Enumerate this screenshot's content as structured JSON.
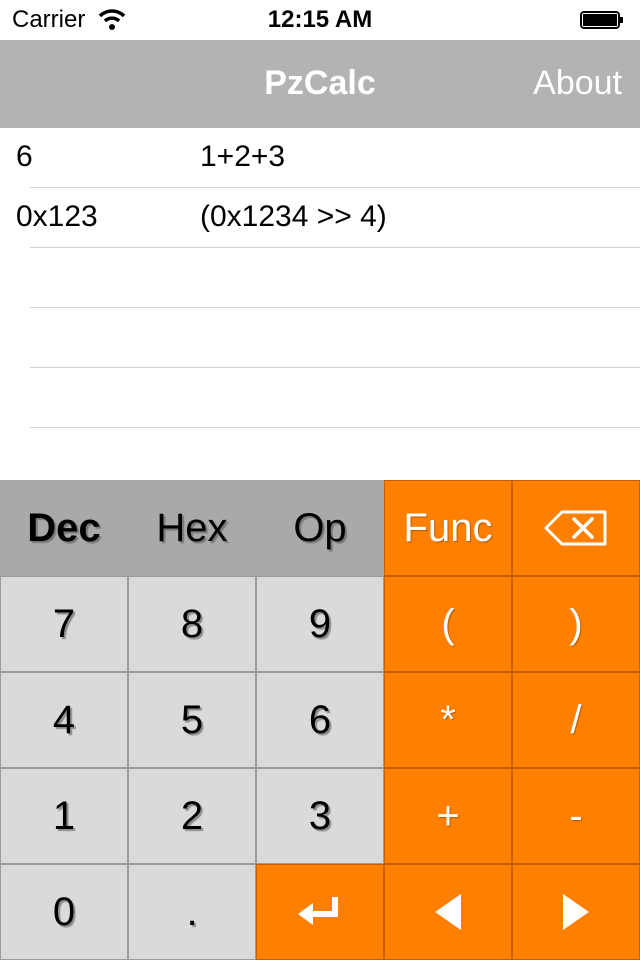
{
  "status_bar": {
    "carrier": "Carrier",
    "time": "12:15 AM"
  },
  "nav": {
    "title": "PzCalc",
    "about_label": "About"
  },
  "history": [
    {
      "result": "6",
      "expression": "1+2+3"
    },
    {
      "result": "0x123",
      "expression": "(0x1234 >> 4)"
    },
    {
      "result": "",
      "expression": ""
    },
    {
      "result": "",
      "expression": ""
    },
    {
      "result": "",
      "expression": ""
    }
  ],
  "keypad": {
    "modes": [
      "Dec",
      "Hex",
      "Op"
    ],
    "active_mode": "Dec",
    "func_label": "Func",
    "backspace_icon": "backspace-icon",
    "digits": [
      "7",
      "8",
      "9",
      "4",
      "5",
      "6",
      "1",
      "2",
      "3",
      "0",
      "."
    ],
    "operators": [
      "(",
      ")",
      "*",
      "/",
      "+",
      "-"
    ],
    "enter_icon": "enter-icon",
    "left_icon": "arrow-left-icon",
    "right_icon": "arrow-right-icon"
  },
  "colors": {
    "accent": "#ff8000",
    "nav_bg": "#b3b3b3",
    "key_gray": "#dadada",
    "mode_bg": "#a9a9a9"
  }
}
